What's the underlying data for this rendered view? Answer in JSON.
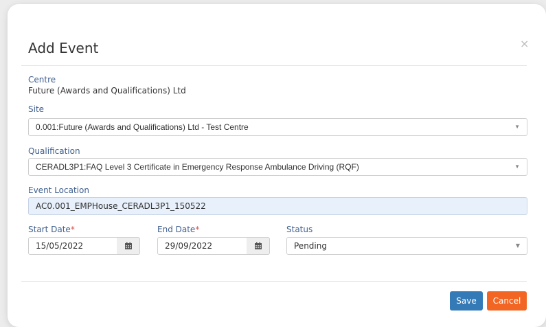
{
  "modal": {
    "title": "Add Event",
    "close_icon": "×"
  },
  "centre": {
    "label": "Centre",
    "value": "Future (Awards and Qualifications) Ltd"
  },
  "site": {
    "label": "Site",
    "value": "0.001:Future (Awards and Qualifications) Ltd - Test Centre"
  },
  "qualification": {
    "label": "Qualification",
    "value": "CERADL3P1:FAQ Level 3 Certificate in Emergency Response Ambulance Driving (RQF)"
  },
  "event_location": {
    "label": "Event Location",
    "value": "AC0.001_EMPHouse_CERADL3P1_150522"
  },
  "start_date": {
    "label": "Start Date",
    "required_mark": "*",
    "value": "15/05/2022",
    "icon": "calendar-icon"
  },
  "end_date": {
    "label": "End Date",
    "required_mark": "*",
    "value": "29/09/2022",
    "icon": "calendar-icon"
  },
  "status": {
    "label": "Status",
    "value": "Pending"
  },
  "footer": {
    "save_label": "Save",
    "cancel_label": "Cancel"
  },
  "colors": {
    "save": "#337ab7",
    "cancel": "#f26522",
    "label": "#3f5f8f",
    "input_filled": "#e8f0fb"
  }
}
